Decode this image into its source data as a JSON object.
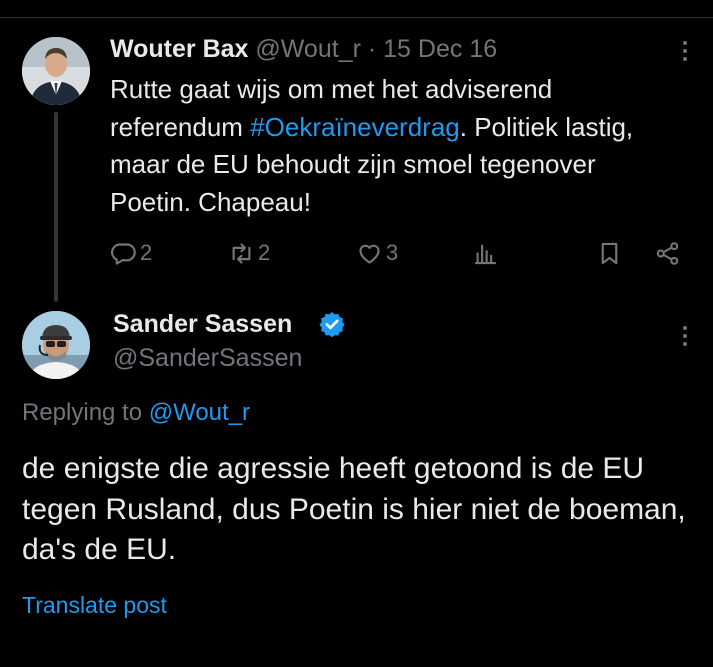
{
  "colors": {
    "background": "#000000",
    "text": "#e7e9ea",
    "muted": "#71767b",
    "accent": "#1d9bf0",
    "divider": "#2f3336"
  },
  "tweet1": {
    "author_name": "Wouter Bax",
    "handle": "@Wout_r",
    "separator": "·",
    "date": "15 Dec 16",
    "text_before": "Rutte gaat wijs om met het adviserend referendum ",
    "hashtag": "#Oekraïneverdrag",
    "text_after": ". Politiek lastig, maar de EU behoudt zijn smoel tegenover Poetin. Chapeau!",
    "avatar_icon": "profile-photo-man-in-suit",
    "more_icon": "more-vertical-icon",
    "actions": {
      "replies": "2",
      "reposts": "2",
      "likes": "3",
      "views": "",
      "reply_icon": "reply-icon",
      "repost_icon": "repost-icon",
      "like_icon": "heart-icon",
      "views_icon": "analytics-icon",
      "bookmark_icon": "bookmark-icon",
      "share_icon": "share-icon"
    }
  },
  "tweet2": {
    "author_name": "Sander Sassen",
    "verified_icon": "verified-badge-icon",
    "handle": "@SanderSassen",
    "avatar_icon": "profile-photo-man-with-cap-and-headset",
    "more_icon": "more-vertical-icon",
    "replying_prefix": "Replying to ",
    "replying_to": "@Wout_r",
    "text": "de enigste die agressie heeft getoond is de EU tegen Rusland, dus Poetin is hier niet de boeman, da's de EU.",
    "translate_label": "Translate post"
  }
}
